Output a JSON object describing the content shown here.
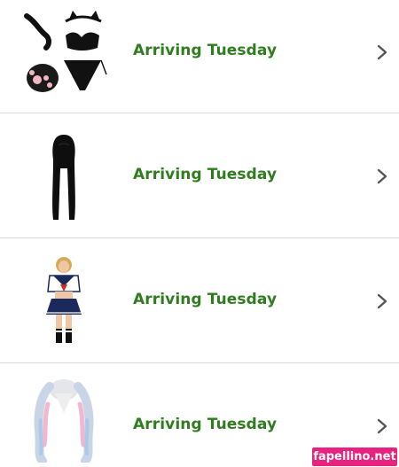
{
  "orders": [
    {
      "status": "Arriving Tuesday",
      "product_image": "cat-ear-lingerie-set-with-paw-gloves-and-tail"
    },
    {
      "status": "Arriving Tuesday",
      "product_image": "long-black-wig"
    },
    {
      "status": "Arriving Tuesday",
      "product_image": "sailor-schoolgirl-costume"
    },
    {
      "status": "Arriving Tuesday",
      "product_image": "pastel-pink-blue-pigtail-wig"
    }
  ],
  "icons": {
    "row_action": "chevron-right-icon"
  },
  "colors": {
    "status_green": "#2f7d1f",
    "divider": "#d5d9d9",
    "chevron": "#555555",
    "watermark_bg": "#e8237f"
  },
  "watermark": {
    "text": "fapellino.net"
  }
}
